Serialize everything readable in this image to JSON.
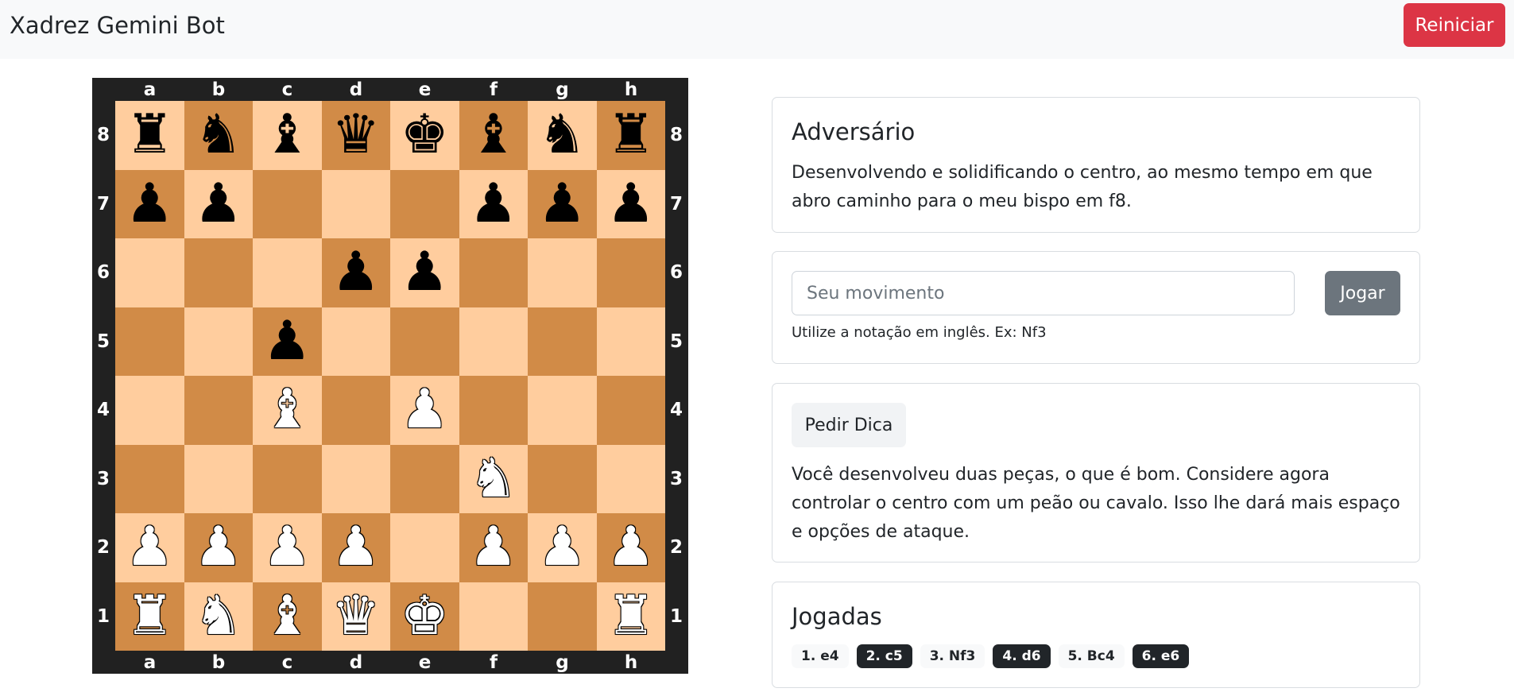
{
  "header": {
    "title": "Xadrez Gemini Bot",
    "restart_label": "Reiniciar"
  },
  "board": {
    "files": [
      "a",
      "b",
      "c",
      "d",
      "e",
      "f",
      "g",
      "h"
    ],
    "ranks": [
      "8",
      "7",
      "6",
      "5",
      "4",
      "3",
      "2",
      "1"
    ],
    "rows": [
      [
        "br",
        "bn",
        "bb",
        "bq",
        "bk",
        "bb",
        "bn",
        "br"
      ],
      [
        "bp",
        "bp",
        "",
        "",
        "",
        "bp",
        "bp",
        "bp"
      ],
      [
        "",
        "",
        "",
        "bp",
        "bp",
        "",
        "",
        ""
      ],
      [
        "",
        "",
        "bp",
        "",
        "",
        "",
        "",
        ""
      ],
      [
        "",
        "",
        "wb",
        "",
        "wp",
        "",
        "",
        ""
      ],
      [
        "",
        "",
        "",
        "",
        "",
        "wn",
        "",
        ""
      ],
      [
        "wp",
        "wp",
        "wp",
        "wp",
        "",
        "wp",
        "wp",
        "wp"
      ],
      [
        "wr",
        "wn",
        "wb",
        "wq",
        "wk",
        "",
        "",
        "wr"
      ]
    ],
    "colors": {
      "light": "#ffcd9e",
      "dark": "#d18b47",
      "frame": "#212121"
    }
  },
  "opponent": {
    "title": "Adversário",
    "message": "Desenvolvendo e solidificando o centro, ao mesmo tempo em que abro caminho para o meu bispo em f8."
  },
  "move_form": {
    "placeholder": "Seu movimento",
    "value": "",
    "submit_label": "Jogar",
    "help": "Utilize a notação em inglês. Ex: Nf3"
  },
  "hint": {
    "button_label": "Pedir Dica",
    "text": "Você desenvolveu duas peças, o que é bom. Considere agora controlar o centro com um peão ou cavalo. Isso lhe dará mais espaço e opções de ataque."
  },
  "moves": {
    "title": "Jogadas",
    "items": [
      {
        "label": "1. e4",
        "style": "light"
      },
      {
        "label": "2. c5",
        "style": "dark"
      },
      {
        "label": "3. Nf3",
        "style": "light"
      },
      {
        "label": "4. d6",
        "style": "dark"
      },
      {
        "label": "5. Bc4",
        "style": "light"
      },
      {
        "label": "6. e6",
        "style": "dark"
      }
    ]
  },
  "accent_colors": {
    "danger": "#dc3545",
    "secondary": "#6c757d"
  }
}
